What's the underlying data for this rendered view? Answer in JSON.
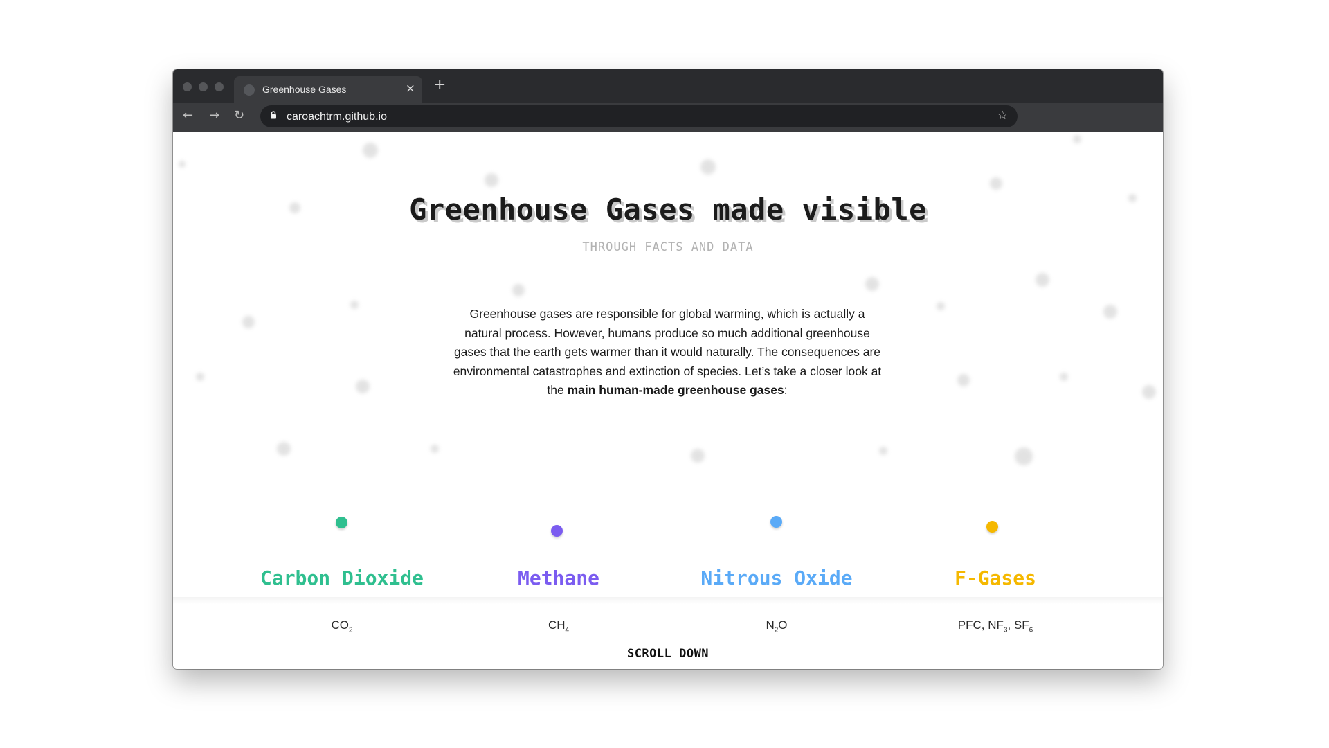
{
  "browser": {
    "tab_title": "Greenhouse Gases",
    "close_icon": "×",
    "new_tab_icon": "+",
    "back_icon": "←",
    "forward_icon": "→",
    "reload_icon": "↻",
    "url": "caroachtrm.github.io",
    "bookmark_icon": "☆"
  },
  "hero": {
    "title": "Greenhouse Gases made visible",
    "subtitle": "THROUGH FACTS AND DATA"
  },
  "intro": {
    "text": "Greenhouse gases are responsible for global warming, which is actually a natural process. However, humans produce so much additional greenhouse gases that the earth gets warmer than it would naturally. The consequences are environmental catastrophes and extinction of species. Let’s take a closer look at the ",
    "emphasis": "main human-made greenhouse gases",
    "suffix": ":"
  },
  "gases": [
    {
      "name": "Carbon Dioxide",
      "formula_base": "CO",
      "formula_sub": "2",
      "formula_rest": "",
      "color": "#2fbf8f"
    },
    {
      "name": "Methane",
      "formula_base": "CH",
      "formula_sub": "4",
      "formula_rest": "",
      "color": "#7b5cf0"
    },
    {
      "name": "Nitrous Oxide",
      "formula_base": "N",
      "formula_sub": "2",
      "formula_rest": "O",
      "color": "#5aaaf7"
    },
    {
      "name": "F-Gases",
      "formula_base": "PFC, NF",
      "formula_sub": "3",
      "formula_rest": ", SF",
      "formula_sub2": "6",
      "color": "#f5b800"
    }
  ],
  "scroll_label": "SCROLL DOWN"
}
